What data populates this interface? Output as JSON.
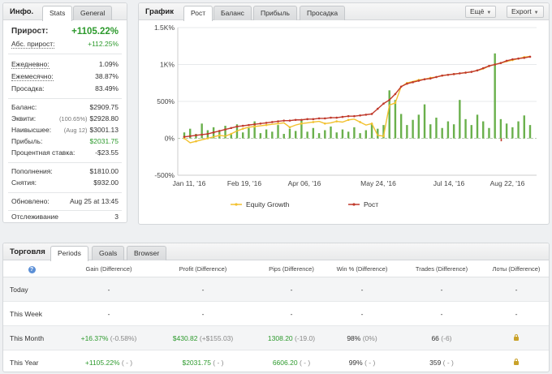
{
  "stats_panel": {
    "title": "Инфо.",
    "tabs": [
      "Stats",
      "General"
    ],
    "rows": [
      {
        "key": "Прирост:",
        "value": "+1105.22%"
      },
      {
        "key": "Абс. прирост:",
        "value": "+112.25%"
      },
      {
        "key": "Ежедневно:",
        "value": "1.09%"
      },
      {
        "key": "Ежемесячно:",
        "value": "38.87%"
      },
      {
        "key": "Просадка:",
        "value": "83.49%"
      },
      {
        "key": "Баланс:",
        "value": "$2909.75"
      },
      {
        "key": "Эквити:",
        "note": "(100.65%)",
        "value": "$2928.80"
      },
      {
        "key": "Наивысшее:",
        "note": "(Aug 12)",
        "value": "$3001.13"
      },
      {
        "key": "Прибыль:",
        "value": "$2031.75"
      },
      {
        "key": "Процентная ставка:",
        "value": "-$23.55"
      },
      {
        "key": "Пополнения:",
        "value": "$1810.00"
      },
      {
        "key": "Снятия:",
        "value": "$932.00"
      },
      {
        "key": "Обновлено:",
        "value": "Aug 25 at 13:45"
      },
      {
        "key": "Отслеживание",
        "value": "3"
      }
    ]
  },
  "chart_panel": {
    "title": "График",
    "tabs": [
      "Рост",
      "Баланс",
      "Прибыль",
      "Просадка"
    ],
    "more_button": "Ещё",
    "export_button": "Export"
  },
  "chart_data": {
    "type": "line",
    "x_ticks": [
      "Jan 11, '16",
      "Feb 19, '16",
      "Apr 06, '16",
      "May 24, '16",
      "Jul 14, '16",
      "Aug 22, '16"
    ],
    "y_ticks": [
      "1.5K%",
      "1K%",
      "500%",
      "0%",
      "-500%"
    ],
    "ylim": [
      -500,
      1500
    ],
    "legend_position": "bottom",
    "series": [
      {
        "name": "Equity Growth",
        "color": "#f2c12e",
        "values": [
          0,
          -60,
          -40,
          -20,
          0,
          20,
          40,
          30,
          60,
          100,
          130,
          150,
          160,
          170,
          180,
          190,
          200,
          210,
          150,
          180,
          200,
          210,
          220,
          230,
          200,
          210,
          230,
          220,
          250,
          260,
          220,
          180,
          200,
          40,
          30,
          450,
          480,
          700,
          750,
          770,
          790,
          800,
          820,
          830,
          850,
          860,
          870,
          880,
          890,
          900,
          920,
          940,
          980,
          1000,
          1020,
          1040,
          1060,
          1080,
          1100,
          1110
        ]
      },
      {
        "name": "Рост",
        "color": "#c0392b",
        "values": [
          20,
          30,
          40,
          50,
          60,
          80,
          100,
          120,
          140,
          160,
          170,
          180,
          190,
          200,
          210,
          220,
          230,
          240,
          240,
          250,
          250,
          260,
          260,
          270,
          270,
          280,
          280,
          290,
          300,
          300,
          310,
          320,
          330,
          400,
          470,
          520,
          600,
          700,
          740,
          760,
          780,
          800,
          810,
          830,
          850,
          860,
          870,
          880,
          890,
          900,
          920,
          950,
          980,
          1000,
          1020,
          1050,
          1070,
          1080,
          1090,
          1105
        ]
      },
      {
        "name": "bars",
        "color": "#6ab04c",
        "values": [
          80,
          130,
          60,
          200,
          110,
          150,
          90,
          170,
          60,
          190,
          80,
          140,
          230,
          70,
          120,
          90,
          180,
          60,
          130,
          100,
          260,
          90,
          140,
          70,
          110,
          160,
          80,
          120,
          90,
          150,
          70,
          110,
          200,
          130,
          180,
          650,
          520,
          330,
          180,
          250,
          320,
          460,
          190,
          280,
          140,
          230,
          190,
          520,
          260,
          180,
          320,
          230,
          140,
          1150,
          260,
          200,
          150,
          230,
          310,
          180
        ]
      }
    ]
  },
  "trading_panel": {
    "title": "Торговля",
    "tabs": [
      "Periods",
      "Goals",
      "Browser"
    ],
    "help_icon": "?",
    "columns": [
      "Gain (Difference)",
      "Profit (Difference)",
      "Pips (Difference)",
      "Win % (Difference)",
      "Trades (Difference)",
      "Лоты (Difference)"
    ],
    "rows": [
      {
        "label": "Today",
        "gain": "-",
        "gain_diff": "",
        "profit": "-",
        "profit_diff": "",
        "pips": "-",
        "pips_diff": "",
        "win": "-",
        "win_diff": "",
        "trades": "-",
        "trades_diff": "",
        "lots": "-"
      },
      {
        "label": "This Week",
        "gain": "-",
        "gain_diff": "",
        "profit": "-",
        "profit_diff": "",
        "pips": "-",
        "pips_diff": "",
        "win": "-",
        "win_diff": "",
        "trades": "-",
        "trades_diff": "",
        "lots": "-"
      },
      {
        "label": "This Month",
        "gain": "+16.37%",
        "gain_diff": "(-0.58%)",
        "profit": "$430.82",
        "profit_diff": "(+$155.03)",
        "pips": "1308.20",
        "pips_diff": "(-19.0)",
        "win": "98%",
        "win_diff": "(0%)",
        "trades": "66",
        "trades_diff": "(-6)",
        "lots": "lock"
      },
      {
        "label": "This Year",
        "gain": "+1105.22%",
        "gain_diff": "( - )",
        "profit": "$2031.75",
        "profit_diff": "( - )",
        "pips": "6606.20",
        "pips_diff": "( - )",
        "win": "99%",
        "win_diff": "( - )",
        "trades": "359",
        "trades_diff": "( - )",
        "lots": "lock"
      }
    ]
  }
}
